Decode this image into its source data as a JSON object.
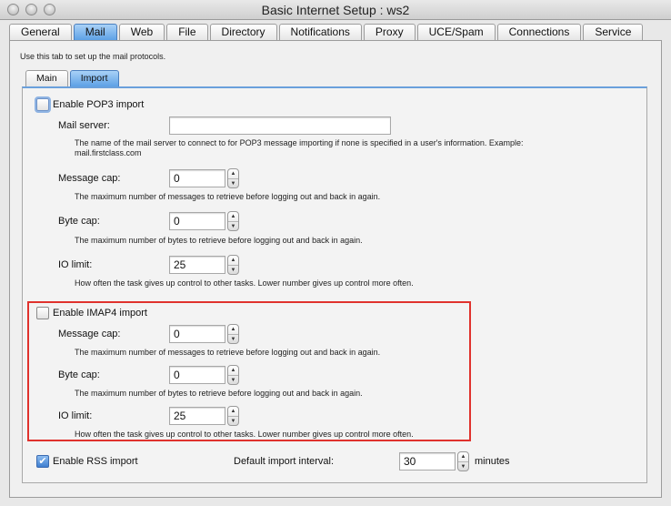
{
  "window": {
    "title": "Basic Internet Setup : ws2"
  },
  "main_tabs": [
    {
      "label": "General"
    },
    {
      "label": "Mail",
      "active": true
    },
    {
      "label": "Web"
    },
    {
      "label": "File"
    },
    {
      "label": "Directory"
    },
    {
      "label": "Notifications"
    },
    {
      "label": "Proxy"
    },
    {
      "label": "UCE/Spam"
    },
    {
      "label": "Connections"
    },
    {
      "label": "Service"
    }
  ],
  "intro_text": "Use this tab to set up the mail protocols.",
  "sub_tabs": [
    {
      "label": "Main"
    },
    {
      "label": "Import",
      "active": true
    }
  ],
  "pop3": {
    "enable_label": "Enable POP3 import",
    "checked": false,
    "mail_server_label": "Mail server:",
    "mail_server_value": "",
    "mail_server_help": "The name of the mail server to connect to for POP3 message importing if none is specified in a user's information. Example: mail.firstclass.com",
    "message_cap_label": "Message cap:",
    "message_cap_value": "0",
    "message_cap_help": "The maximum number of messages to retrieve before logging out and back in again.",
    "byte_cap_label": "Byte cap:",
    "byte_cap_value": "0",
    "byte_cap_help": "The maximum number of bytes to retrieve before logging out and back in again.",
    "io_limit_label": "IO limit:",
    "io_limit_value": "25",
    "io_limit_help": "How often the task gives up control to other tasks. Lower number gives up control more often."
  },
  "imap4": {
    "enable_label": "Enable IMAP4 import",
    "checked": false,
    "message_cap_label": "Message cap:",
    "message_cap_value": "0",
    "message_cap_help": "The maximum number of messages to retrieve before logging out and back in again.",
    "byte_cap_label": "Byte cap:",
    "byte_cap_value": "0",
    "byte_cap_help": "The maximum number of bytes to retrieve before logging out and back in again.",
    "io_limit_label": "IO limit:",
    "io_limit_value": "25",
    "io_limit_help": "How often the task gives up control to other tasks. Lower number gives up control more often."
  },
  "rss": {
    "enable_label": "Enable RSS import",
    "checked": true,
    "checkmark": "✔",
    "interval_label": "Default import interval:",
    "interval_value": "30",
    "interval_unit": "minutes"
  },
  "highlight_color": "#e0322d",
  "accent_color": "#5ea1e6"
}
